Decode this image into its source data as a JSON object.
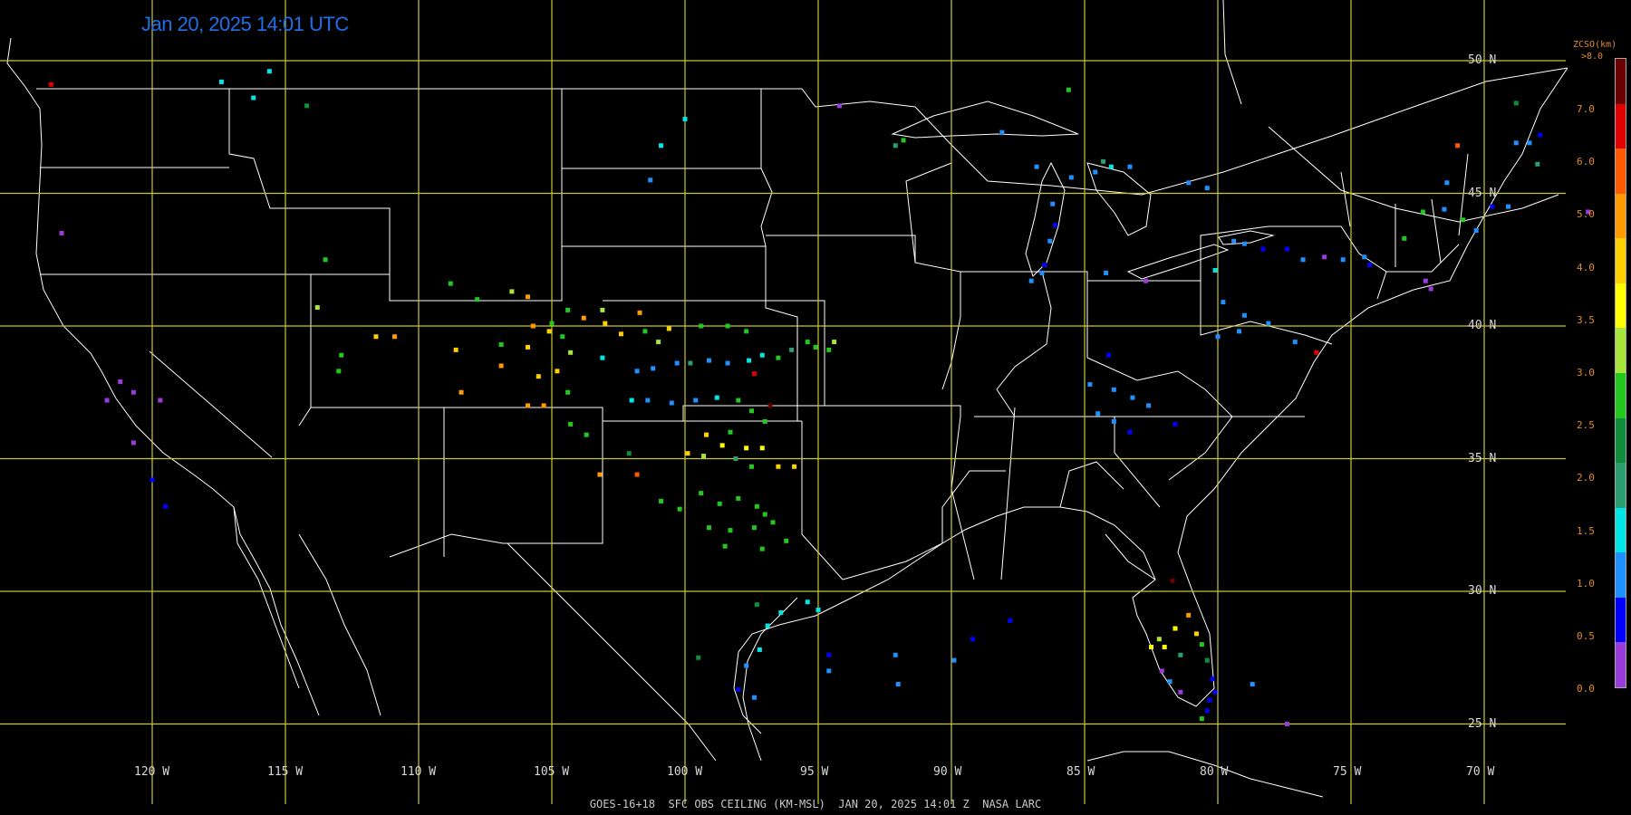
{
  "header": {
    "timestamp": "Jan 20, 2025 14:01 UTC"
  },
  "footer": {
    "caption": "GOES-16+18  SFC OBS CEILING (KM-MSL)  JAN 20, 2025 14:01 Z  NASA LARC"
  },
  "grid": {
    "latitudes": [
      "50 N",
      "45 N",
      "40 N",
      "35 N",
      "30 N",
      "25 N"
    ],
    "longitudes": [
      "120 W",
      "115 W",
      "110 W",
      "105 W",
      "100 W",
      "95 W",
      "90 W",
      "85 W",
      "80 W",
      "75 W",
      "70 W"
    ]
  },
  "legend": {
    "title": "ZCSO(km)",
    "top_label": ">8.0",
    "ticks": [
      "7.0",
      "6.0",
      "5.0",
      "4.0",
      "3.5",
      "3.0",
      "2.5",
      "2.0",
      "1.5",
      "1.0",
      "0.5",
      "0.0"
    ],
    "colors": [
      "#6b0000",
      "#e00000",
      "#ff5a00",
      "#ff9a00",
      "#ffd000",
      "#ffff00",
      "#a8e63c",
      "#23c81e",
      "#0f8c3c",
      "#2aa070",
      "#00e6e6",
      "#1e90ff",
      "#0000ff",
      "#9a3cdc"
    ]
  },
  "colors": {
    "grid": "#c8c832",
    "borders": "#ffffff",
    "background": "#000000"
  },
  "observations": [
    {
      "lon": -123.8,
      "lat": 49.1,
      "color": "#e00000"
    },
    {
      "lon": -117.4,
      "lat": 49.2,
      "color": "#00e6e6"
    },
    {
      "lon": -115.6,
      "lat": 49.6,
      "color": "#00e6e6"
    },
    {
      "lon": -116.2,
      "lat": 48.6,
      "color": "#00e6e6"
    },
    {
      "lon": -114.2,
      "lat": 48.3,
      "color": "#0f8c3c"
    },
    {
      "lon": -123.4,
      "lat": 43.5,
      "color": "#9a3cdc"
    },
    {
      "lon": -113.5,
      "lat": 42.5,
      "color": "#23c81e"
    },
    {
      "lon": -113.8,
      "lat": 40.7,
      "color": "#a8e63c"
    },
    {
      "lon": -121.2,
      "lat": 37.9,
      "color": "#9a3cdc"
    },
    {
      "lon": -120.7,
      "lat": 37.5,
      "color": "#9a3cdc"
    },
    {
      "lon": -119.7,
      "lat": 37.2,
      "color": "#9a3cdc"
    },
    {
      "lon": -121.7,
      "lat": 37.2,
      "color": "#9a3cdc"
    },
    {
      "lon": -120.7,
      "lat": 35.6,
      "color": "#9a3cdc"
    },
    {
      "lon": -120.0,
      "lat": 34.2,
      "color": "#0000ff"
    },
    {
      "lon": -119.5,
      "lat": 33.2,
      "color": "#0000ff"
    },
    {
      "lon": -111.6,
      "lat": 39.6,
      "color": "#ffd000"
    },
    {
      "lon": -110.9,
      "lat": 39.6,
      "color": "#ff9a00"
    },
    {
      "lon": -112.9,
      "lat": 38.9,
      "color": "#23c81e"
    },
    {
      "lon": -113.0,
      "lat": 38.3,
      "color": "#23c81e"
    },
    {
      "lon": -108.8,
      "lat": 41.6,
      "color": "#23c81e"
    },
    {
      "lon": -107.8,
      "lat": 41.0,
      "color": "#23c81e"
    },
    {
      "lon": -106.5,
      "lat": 41.3,
      "color": "#a8e63c"
    },
    {
      "lon": -105.9,
      "lat": 41.1,
      "color": "#ff9a00"
    },
    {
      "lon": -104.4,
      "lat": 40.6,
      "color": "#23c81e"
    },
    {
      "lon": -103.8,
      "lat": 40.3,
      "color": "#ff9a00"
    },
    {
      "lon": -103.1,
      "lat": 40.6,
      "color": "#a8e63c"
    },
    {
      "lon": -103.0,
      "lat": 40.1,
      "color": "#ffd000"
    },
    {
      "lon": -101.7,
      "lat": 40.5,
      "color": "#ff9a00"
    },
    {
      "lon": -105.7,
      "lat": 40.0,
      "color": "#ff9a00"
    },
    {
      "lon": -105.0,
      "lat": 40.1,
      "color": "#23c81e"
    },
    {
      "lon": -105.1,
      "lat": 39.8,
      "color": "#ffd000"
    },
    {
      "lon": -104.6,
      "lat": 39.6,
      "color": "#23c81e"
    },
    {
      "lon": -104.3,
      "lat": 39.0,
      "color": "#a8e63c"
    },
    {
      "lon": -105.9,
      "lat": 39.2,
      "color": "#ffd000"
    },
    {
      "lon": -106.9,
      "lat": 39.3,
      "color": "#23c81e"
    },
    {
      "lon": -108.6,
      "lat": 39.1,
      "color": "#ffd000"
    },
    {
      "lon": -104.8,
      "lat": 38.3,
      "color": "#ffd000"
    },
    {
      "lon": -105.5,
      "lat": 38.1,
      "color": "#ffd000"
    },
    {
      "lon": -106.9,
      "lat": 38.5,
      "color": "#ff9a00"
    },
    {
      "lon": -108.4,
      "lat": 37.5,
      "color": "#ff9a00"
    },
    {
      "lon": -105.9,
      "lat": 37.0,
      "color": "#ff9a00"
    },
    {
      "lon": -105.3,
      "lat": 37.0,
      "color": "#ff9a00"
    },
    {
      "lon": -104.4,
      "lat": 37.5,
      "color": "#23c81e"
    },
    {
      "lon": -104.3,
      "lat": 36.3,
      "color": "#23c81e"
    },
    {
      "lon": -103.7,
      "lat": 35.9,
      "color": "#23c81e"
    },
    {
      "lon": -103.2,
      "lat": 34.4,
      "color": "#ff9a00"
    },
    {
      "lon": -103.1,
      "lat": 38.8,
      "color": "#00e6e6"
    },
    {
      "lon": -102.4,
      "lat": 39.7,
      "color": "#ffd000"
    },
    {
      "lon": -101.5,
      "lat": 39.8,
      "color": "#23c81e"
    },
    {
      "lon": -101.0,
      "lat": 39.4,
      "color": "#a8e63c"
    },
    {
      "lon": -100.6,
      "lat": 39.9,
      "color": "#ffd000"
    },
    {
      "lon": -99.4,
      "lat": 40.0,
      "color": "#23c81e"
    },
    {
      "lon": -98.4,
      "lat": 40.0,
      "color": "#23c81e"
    },
    {
      "lon": -97.7,
      "lat": 39.8,
      "color": "#23c81e"
    },
    {
      "lon": -101.8,
      "lat": 38.3,
      "color": "#1e90ff"
    },
    {
      "lon": -101.2,
      "lat": 38.4,
      "color": "#1e90ff"
    },
    {
      "lon": -100.3,
      "lat": 38.6,
      "color": "#1e90ff"
    },
    {
      "lon": -99.8,
      "lat": 38.6,
      "color": "#2aa070"
    },
    {
      "lon": -99.1,
      "lat": 38.7,
      "color": "#1e90ff"
    },
    {
      "lon": -98.4,
      "lat": 38.6,
      "color": "#1e90ff"
    },
    {
      "lon": -97.6,
      "lat": 38.7,
      "color": "#00e6e6"
    },
    {
      "lon": -97.1,
      "lat": 38.9,
      "color": "#00e6e6"
    },
    {
      "lon": -96.5,
      "lat": 38.8,
      "color": "#23c81e"
    },
    {
      "lon": -96.0,
      "lat": 39.1,
      "color": "#2aa070"
    },
    {
      "lon": -95.4,
      "lat": 39.4,
      "color": "#23c81e"
    },
    {
      "lon": -95.1,
      "lat": 39.2,
      "color": "#23c81e"
    },
    {
      "lon": -94.6,
      "lat": 39.1,
      "color": "#23c81e"
    },
    {
      "lon": -94.4,
      "lat": 39.4,
      "color": "#a8e63c"
    },
    {
      "lon": -97.4,
      "lat": 38.2,
      "color": "#e00000"
    },
    {
      "lon": -96.8,
      "lat": 37.0,
      "color": "#6b0000"
    },
    {
      "lon": -102.0,
      "lat": 37.2,
      "color": "#00e6e6"
    },
    {
      "lon": -101.4,
      "lat": 37.2,
      "color": "#1e90ff"
    },
    {
      "lon": -100.5,
      "lat": 37.1,
      "color": "#1e90ff"
    },
    {
      "lon": -99.6,
      "lat": 37.2,
      "color": "#1e90ff"
    },
    {
      "lon": -98.8,
      "lat": 37.3,
      "color": "#00e6e6"
    },
    {
      "lon": -98.0,
      "lat": 37.2,
      "color": "#23c81e"
    },
    {
      "lon": -97.5,
      "lat": 36.8,
      "color": "#23c81e"
    },
    {
      "lon": -97.0,
      "lat": 36.4,
      "color": "#23c81e"
    },
    {
      "lon": -98.3,
      "lat": 36.0,
      "color": "#23c81e"
    },
    {
      "lon": -99.2,
      "lat": 35.9,
      "color": "#ffd000"
    },
    {
      "lon": -98.6,
      "lat": 35.5,
      "color": "#ffff00"
    },
    {
      "lon": -97.7,
      "lat": 35.4,
      "color": "#ffff00"
    },
    {
      "lon": -97.1,
      "lat": 35.4,
      "color": "#ffff00"
    },
    {
      "lon": -99.9,
      "lat": 35.2,
      "color": "#ffd000"
    },
    {
      "lon": -99.3,
      "lat": 35.1,
      "color": "#a8e63c"
    },
    {
      "lon": -98.1,
      "lat": 35.0,
      "color": "#2aa070"
    },
    {
      "lon": -97.5,
      "lat": 34.7,
      "color": "#23c81e"
    },
    {
      "lon": -96.5,
      "lat": 34.7,
      "color": "#ffd000"
    },
    {
      "lon": -95.9,
      "lat": 34.7,
      "color": "#ffd000"
    },
    {
      "lon": -102.1,
      "lat": 35.2,
      "color": "#0f8c3c"
    },
    {
      "lon": -101.8,
      "lat": 34.4,
      "color": "#ff5a00"
    },
    {
      "lon": -100.9,
      "lat": 33.4,
      "color": "#23c81e"
    },
    {
      "lon": -100.2,
      "lat": 33.1,
      "color": "#23c81e"
    },
    {
      "lon": -99.4,
      "lat": 33.7,
      "color": "#23c81e"
    },
    {
      "lon": -98.7,
      "lat": 33.3,
      "color": "#23c81e"
    },
    {
      "lon": -98.0,
      "lat": 33.5,
      "color": "#23c81e"
    },
    {
      "lon": -97.3,
      "lat": 33.2,
      "color": "#23c81e"
    },
    {
      "lon": -97.0,
      "lat": 32.9,
      "color": "#23c81e"
    },
    {
      "lon": -96.7,
      "lat": 32.6,
      "color": "#23c81e"
    },
    {
      "lon": -97.4,
      "lat": 32.4,
      "color": "#23c81e"
    },
    {
      "lon": -98.3,
      "lat": 32.3,
      "color": "#23c81e"
    },
    {
      "lon": -99.1,
      "lat": 32.4,
      "color": "#23c81e"
    },
    {
      "lon": -98.5,
      "lat": 31.7,
      "color": "#23c81e"
    },
    {
      "lon": -97.1,
      "lat": 31.6,
      "color": "#23c81e"
    },
    {
      "lon": -96.2,
      "lat": 31.9,
      "color": "#23c81e"
    },
    {
      "lon": -97.3,
      "lat": 29.5,
      "color": "#0f8c3c"
    },
    {
      "lon": -96.4,
      "lat": 29.2,
      "color": "#00e6e6"
    },
    {
      "lon": -95.4,
      "lat": 29.6,
      "color": "#00e6e6"
    },
    {
      "lon": -95.0,
      "lat": 29.3,
      "color": "#00e6e6"
    },
    {
      "lon": -96.9,
      "lat": 28.7,
      "color": "#00e6e6"
    },
    {
      "lon": -97.2,
      "lat": 27.8,
      "color": "#00e6e6"
    },
    {
      "lon": -97.7,
      "lat": 27.2,
      "color": "#1e90ff"
    },
    {
      "lon": -98.0,
      "lat": 26.3,
      "color": "#0000ff"
    },
    {
      "lon": -97.4,
      "lat": 26.0,
      "color": "#1e90ff"
    },
    {
      "lon": -99.5,
      "lat": 27.5,
      "color": "#0f8c3c"
    },
    {
      "lon": -94.6,
      "lat": 27.6,
      "color": "#0000ff"
    },
    {
      "lon": -92.1,
      "lat": 27.6,
      "color": "#1e90ff"
    },
    {
      "lon": -92.0,
      "lat": 26.5,
      "color": "#1e90ff"
    },
    {
      "lon": -89.9,
      "lat": 27.4,
      "color": "#1e90ff"
    },
    {
      "lon": -89.2,
      "lat": 28.2,
      "color": "#0000ff"
    },
    {
      "lon": -87.8,
      "lat": 28.9,
      "color": "#0000ff"
    },
    {
      "lon": -94.6,
      "lat": 27.0,
      "color": "#1e90ff"
    },
    {
      "lon": -94.2,
      "lat": 48.3,
      "color": "#9a3cdc"
    },
    {
      "lon": -100.0,
      "lat": 47.8,
      "color": "#00e6e6"
    },
    {
      "lon": -100.9,
      "lat": 46.8,
      "color": "#00e6e6"
    },
    {
      "lon": -101.3,
      "lat": 45.5,
      "color": "#1e90ff"
    },
    {
      "lon": -92.1,
      "lat": 46.8,
      "color": "#2aa070"
    },
    {
      "lon": -91.8,
      "lat": 47.0,
      "color": "#23c81e"
    },
    {
      "lon": -88.1,
      "lat": 47.3,
      "color": "#1e90ff"
    },
    {
      "lon": -85.6,
      "lat": 48.9,
      "color": "#23c81e"
    },
    {
      "lon": -86.8,
      "lat": 46.0,
      "color": "#1e90ff"
    },
    {
      "lon": -85.5,
      "lat": 45.6,
      "color": "#1e90ff"
    },
    {
      "lon": -84.6,
      "lat": 45.8,
      "color": "#1e90ff"
    },
    {
      "lon": -84.3,
      "lat": 46.2,
      "color": "#2aa070"
    },
    {
      "lon": -84.0,
      "lat": 46.0,
      "color": "#00e6e6"
    },
    {
      "lon": -83.3,
      "lat": 46.0,
      "color": "#1e90ff"
    },
    {
      "lon": -81.1,
      "lat": 45.4,
      "color": "#1e90ff"
    },
    {
      "lon": -80.4,
      "lat": 45.2,
      "color": "#1e90ff"
    },
    {
      "lon": -86.2,
      "lat": 44.6,
      "color": "#1e90ff"
    },
    {
      "lon": -86.1,
      "lat": 43.8,
      "color": "#0000ff"
    },
    {
      "lon": -86.3,
      "lat": 43.2,
      "color": "#1e90ff"
    },
    {
      "lon": -86.5,
      "lat": 42.3,
      "color": "#0000ff"
    },
    {
      "lon": -87.0,
      "lat": 41.7,
      "color": "#1e90ff"
    },
    {
      "lon": -86.6,
      "lat": 42.0,
      "color": "#1e90ff"
    },
    {
      "lon": -84.2,
      "lat": 42.0,
      "color": "#1e90ff"
    },
    {
      "lon": -82.7,
      "lat": 41.7,
      "color": "#9a3cdc"
    },
    {
      "lon": -80.1,
      "lat": 42.1,
      "color": "#00e6e6"
    },
    {
      "lon": -79.4,
      "lat": 43.2,
      "color": "#1e90ff"
    },
    {
      "lon": -79.0,
      "lat": 43.1,
      "color": "#1e90ff"
    },
    {
      "lon": -78.3,
      "lat": 42.9,
      "color": "#0000ff"
    },
    {
      "lon": -77.4,
      "lat": 42.9,
      "color": "#0000ff"
    },
    {
      "lon": -76.8,
      "lat": 42.5,
      "color": "#1e90ff"
    },
    {
      "lon": -76.0,
      "lat": 42.6,
      "color": "#9a3cdc"
    },
    {
      "lon": -75.3,
      "lat": 42.5,
      "color": "#1e90ff"
    },
    {
      "lon": -74.5,
      "lat": 42.6,
      "color": "#1e90ff"
    },
    {
      "lon": -74.3,
      "lat": 42.3,
      "color": "#0000ff"
    },
    {
      "lon": -79.8,
      "lat": 40.9,
      "color": "#1e90ff"
    },
    {
      "lon": -79.0,
      "lat": 40.4,
      "color": "#1e90ff"
    },
    {
      "lon": -78.1,
      "lat": 40.1,
      "color": "#1e90ff"
    },
    {
      "lon": -80.0,
      "lat": 39.6,
      "color": "#1e90ff"
    },
    {
      "lon": -79.2,
      "lat": 39.8,
      "color": "#1e90ff"
    },
    {
      "lon": -77.1,
      "lat": 39.4,
      "color": "#1e90ff"
    },
    {
      "lon": -76.3,
      "lat": 39.0,
      "color": "#e00000"
    },
    {
      "lon": -84.1,
      "lat": 38.9,
      "color": "#0000ff"
    },
    {
      "lon": -84.8,
      "lat": 37.8,
      "color": "#1e90ff"
    },
    {
      "lon": -83.9,
      "lat": 37.6,
      "color": "#1e90ff"
    },
    {
      "lon": -83.2,
      "lat": 37.3,
      "color": "#1e90ff"
    },
    {
      "lon": -82.6,
      "lat": 37.0,
      "color": "#1e90ff"
    },
    {
      "lon": -84.5,
      "lat": 36.7,
      "color": "#1e90ff"
    },
    {
      "lon": -83.9,
      "lat": 36.4,
      "color": "#1e90ff"
    },
    {
      "lon": -83.3,
      "lat": 36.0,
      "color": "#0000ff"
    },
    {
      "lon": -81.6,
      "lat": 36.3,
      "color": "#0000ff"
    },
    {
      "lon": -81.7,
      "lat": 30.4,
      "color": "#6b0000"
    },
    {
      "lon": -81.1,
      "lat": 29.1,
      "color": "#ff9a00"
    },
    {
      "lon": -81.6,
      "lat": 28.6,
      "color": "#ffff00"
    },
    {
      "lon": -80.8,
      "lat": 28.4,
      "color": "#ffd000"
    },
    {
      "lon": -82.2,
      "lat": 28.2,
      "color": "#a8e63c"
    },
    {
      "lon": -82.5,
      "lat": 27.9,
      "color": "#ffff00"
    },
    {
      "lon": -82.0,
      "lat": 27.9,
      "color": "#ffff00"
    },
    {
      "lon": -81.4,
      "lat": 27.6,
      "color": "#2aa070"
    },
    {
      "lon": -80.6,
      "lat": 28.0,
      "color": "#23c81e"
    },
    {
      "lon": -80.4,
      "lat": 27.4,
      "color": "#0f8c3c"
    },
    {
      "lon": -82.1,
      "lat": 27.0,
      "color": "#9a3cdc"
    },
    {
      "lon": -81.8,
      "lat": 26.6,
      "color": "#1e90ff"
    },
    {
      "lon": -81.4,
      "lat": 26.2,
      "color": "#9a3cdc"
    },
    {
      "lon": -80.2,
      "lat": 26.7,
      "color": "#0000ff"
    },
    {
      "lon": -80.1,
      "lat": 26.2,
      "color": "#0000ff"
    },
    {
      "lon": -80.3,
      "lat": 25.9,
      "color": "#0000ff"
    },
    {
      "lon": -80.4,
      "lat": 25.5,
      "color": "#0000ff"
    },
    {
      "lon": -80.6,
      "lat": 25.2,
      "color": "#23c81e"
    },
    {
      "lon": -78.7,
      "lat": 26.5,
      "color": "#1e90ff"
    },
    {
      "lon": -77.4,
      "lat": 25.0,
      "color": "#9a3cdc"
    },
    {
      "lon": -73.0,
      "lat": 43.3,
      "color": "#23c81e"
    },
    {
      "lon": -72.3,
      "lat": 44.3,
      "color": "#23c81e"
    },
    {
      "lon": -71.5,
      "lat": 44.4,
      "color": "#1e90ff"
    },
    {
      "lon": -71.4,
      "lat": 45.4,
      "color": "#1e90ff"
    },
    {
      "lon": -70.8,
      "lat": 44.0,
      "color": "#23c81e"
    },
    {
      "lon": -70.3,
      "lat": 43.6,
      "color": "#1e90ff"
    },
    {
      "lon": -69.7,
      "lat": 44.5,
      "color": "#0000ff"
    },
    {
      "lon": -69.1,
      "lat": 44.5,
      "color": "#1e90ff"
    },
    {
      "lon": -68.8,
      "lat": 46.9,
      "color": "#1e90ff"
    },
    {
      "lon": -68.3,
      "lat": 46.9,
      "color": "#1e90ff"
    },
    {
      "lon": -67.9,
      "lat": 47.2,
      "color": "#0000ff"
    },
    {
      "lon": -68.0,
      "lat": 46.1,
      "color": "#2aa070"
    },
    {
      "lon": -68.8,
      "lat": 48.4,
      "color": "#0f8c3c"
    },
    {
      "lon": -66.1,
      "lat": 44.3,
      "color": "#9a3cdc"
    },
    {
      "lon": -71.0,
      "lat": 46.8,
      "color": "#ff5a00"
    },
    {
      "lon": -72.2,
      "lat": 41.7,
      "color": "#9a3cdc"
    },
    {
      "lon": -72.0,
      "lat": 41.4,
      "color": "#9a3cdc"
    }
  ]
}
